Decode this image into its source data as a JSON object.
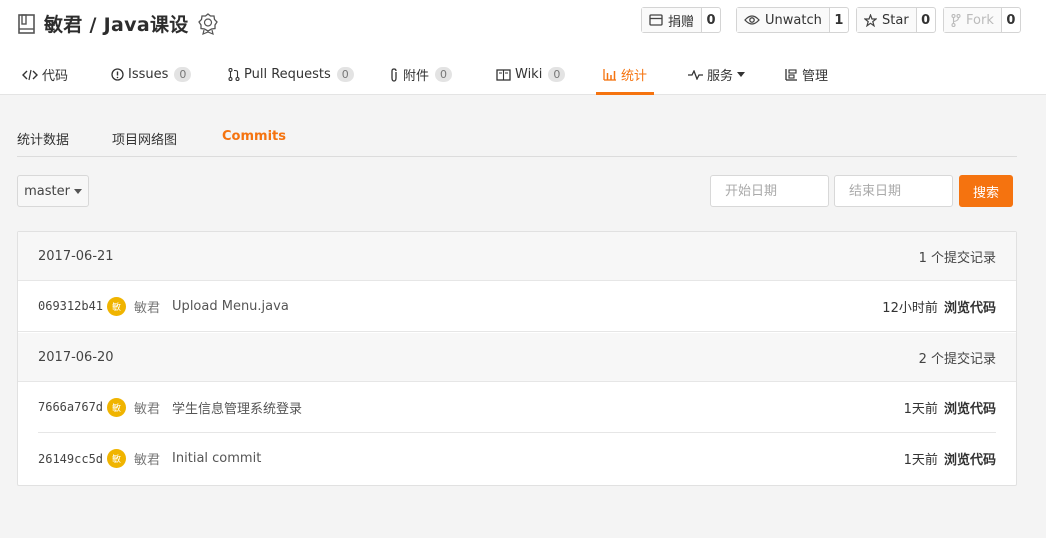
{
  "repo": {
    "title": "敏君 / Java课设"
  },
  "actions": [
    {
      "label": "捐赠",
      "count": "0",
      "icon": "donate-icon"
    },
    {
      "label": "Unwatch",
      "count": "1",
      "icon": "eye-icon"
    },
    {
      "label": "Star",
      "count": "0",
      "icon": "star-icon"
    },
    {
      "label": "Fork",
      "count": "0",
      "icon": "fork-icon"
    }
  ],
  "tabs": [
    {
      "label": "代码",
      "icon": "code-icon"
    },
    {
      "label": "Issues",
      "count": "0",
      "icon": "issue-icon"
    },
    {
      "label": "Pull Requests",
      "count": "0",
      "icon": "pull-request-icon"
    },
    {
      "label": "附件",
      "count": "0",
      "icon": "paperclip-icon"
    },
    {
      "label": "Wiki",
      "count": "0",
      "icon": "book-icon"
    },
    {
      "label": "统计",
      "icon": "bar-chart-icon",
      "active": true
    },
    {
      "label": "服务",
      "icon": "pulse-icon"
    },
    {
      "label": "管理",
      "icon": "settings-icon"
    }
  ],
  "subtabs": [
    "统计数据",
    "项目网络图",
    "Commits"
  ],
  "filter": {
    "branch": "master",
    "start_placeholder": "开始日期",
    "end_placeholder": "结束日期",
    "search_label": "搜索"
  },
  "groups": [
    {
      "date": "2017-06-21",
      "summary": "1 个提交记录",
      "commits": [
        {
          "sha": "069312b41",
          "author": "敏君",
          "message": "Upload Menu.java",
          "time": "12小时前",
          "browse": "浏览代码"
        }
      ]
    },
    {
      "date": "2017-06-20",
      "summary": "2 个提交记录",
      "commits": [
        {
          "sha": "7666a767d",
          "author": "敏君",
          "message": "学生信息管理系统登录",
          "time": "1天前",
          "browse": "浏览代码"
        },
        {
          "sha": "26149cc5d",
          "author": "敏君",
          "message": "Initial commit",
          "time": "1天前",
          "browse": "浏览代码"
        }
      ]
    }
  ],
  "colors": {
    "accent": "#f5730f",
    "avatar": "#f0b400"
  }
}
